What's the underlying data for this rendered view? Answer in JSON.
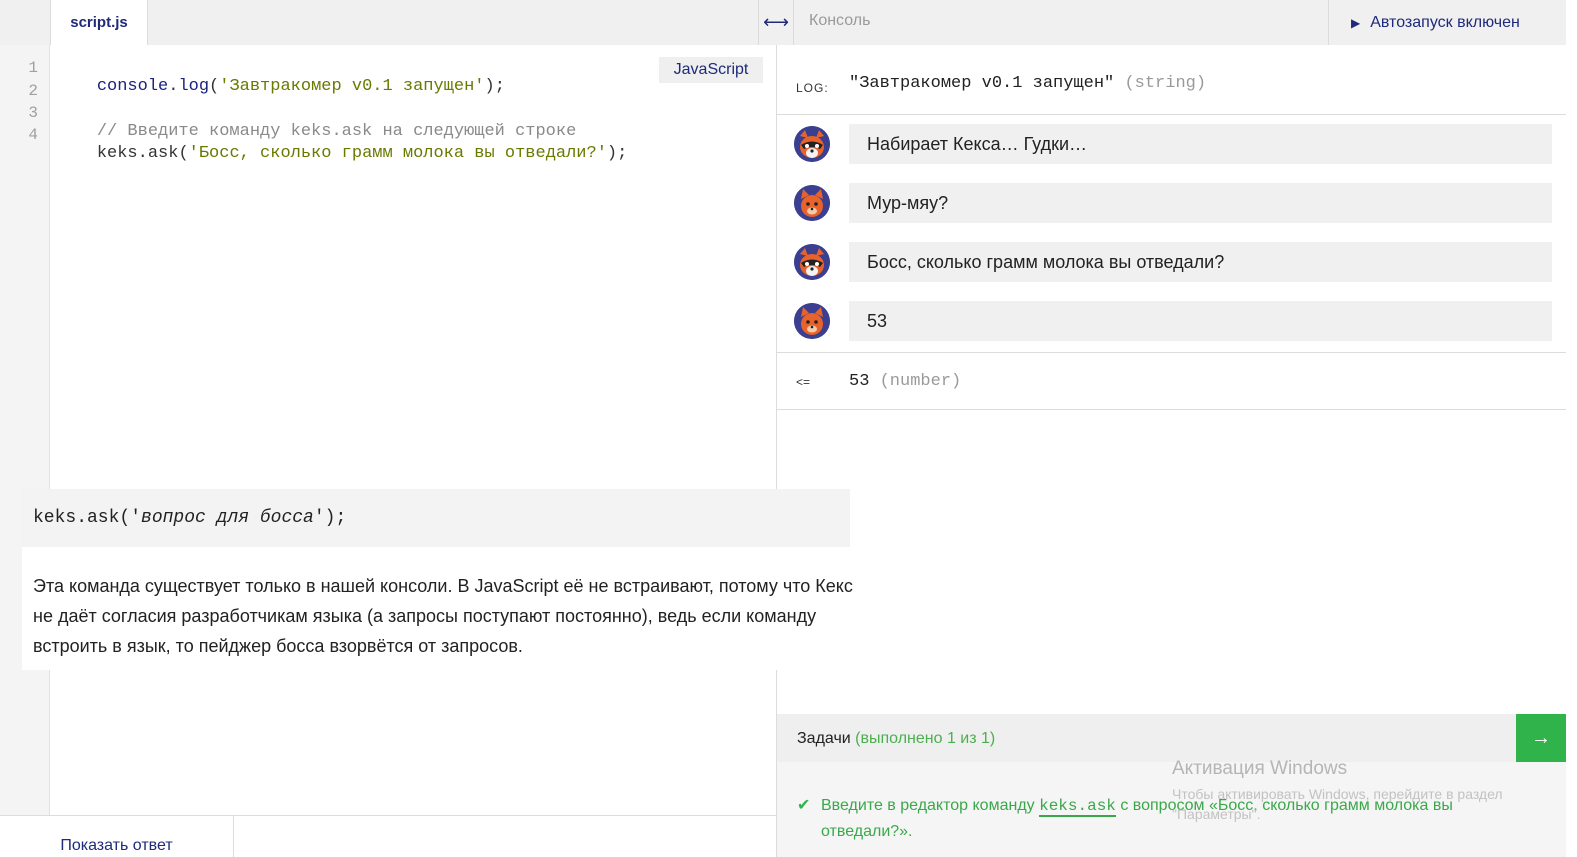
{
  "editor": {
    "tab_label": "script.js",
    "language_badge": "JavaScript",
    "line_numbers": [
      "1",
      "2",
      "3",
      "4"
    ],
    "code": {
      "line1": {
        "obj": "console",
        "dot": ".",
        "method": "log",
        "open": "(",
        "string": "'Завтракомер v0.1 запущен'",
        "close": ");"
      },
      "line3": {
        "comment": "// Введите команду keks.ask на следующей строке"
      },
      "line4": {
        "obj": "keks.ask",
        "open": "(",
        "string": "'Босс, сколько грамм молока вы отведали?'",
        "close": ");"
      }
    },
    "show_answer_label": "Показать ответ"
  },
  "splitter": {
    "icon": "resize-horizontal-icon",
    "glyph": "⟷"
  },
  "console": {
    "title": "Консоль",
    "autorun_icon": "play-icon",
    "autorun_label": "Автозапуск включен",
    "log": {
      "label": "LOG:",
      "value": "\"Завтракомер v0.1 запущен\"",
      "type": "(string)"
    },
    "messages": [
      {
        "speaker": "raccoon",
        "text": "Набирает Кекса… Гудки…"
      },
      {
        "speaker": "cat",
        "text": "Мур-мяу?"
      },
      {
        "speaker": "raccoon",
        "text": "Босс, сколько грамм молока вы отведали?"
      },
      {
        "speaker": "cat",
        "text": "53"
      }
    ],
    "result": {
      "arrow": "<=",
      "value": "53",
      "type": "(number)"
    }
  },
  "tasks": {
    "title": "Задачи",
    "progress": "(выполнено 1 из 1)",
    "next_icon": "arrow-right-icon",
    "next_glyph": "→",
    "items": [
      {
        "done": true,
        "before": "Введите в редактор команду ",
        "code": "keks.ask",
        "after": " с вопросом «Босс, сколько грамм молока вы отведали?»."
      }
    ]
  },
  "watermark": {
    "title": "Активация Windows",
    "subtitle": "Чтобы активировать Windows, перейдите в раздел \"Параметры\"."
  },
  "hint": {
    "code_prefix": "keks.ask('",
    "code_arg": "вопрос для босса",
    "code_suffix": "');",
    "text": "Эта команда существует только в нашей консоли. В JavaScript её не встраивают, потому что Кекс не даёт согласия разработчикам языка (а запросы поступают постоянно), ведь если команду встроить в язык, то пейджер босса взорвётся от запросов."
  },
  "colors": {
    "accent": "#1f2a7a",
    "success": "#2fb34a",
    "string": "#6a7a00",
    "comment": "#8a8a8a"
  }
}
